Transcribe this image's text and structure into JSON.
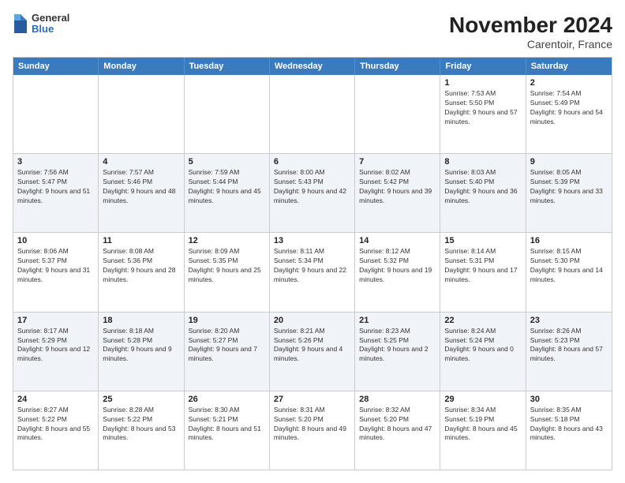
{
  "header": {
    "logo": {
      "general": "General",
      "blue": "Blue"
    },
    "title": "November 2024",
    "location": "Carentoir, France"
  },
  "weekdays": [
    "Sunday",
    "Monday",
    "Tuesday",
    "Wednesday",
    "Thursday",
    "Friday",
    "Saturday"
  ],
  "rows": [
    {
      "alt": false,
      "cells": [
        {
          "day": "",
          "info": ""
        },
        {
          "day": "",
          "info": ""
        },
        {
          "day": "",
          "info": ""
        },
        {
          "day": "",
          "info": ""
        },
        {
          "day": "",
          "info": ""
        },
        {
          "day": "1",
          "info": "Sunrise: 7:53 AM\nSunset: 5:50 PM\nDaylight: 9 hours and 57 minutes."
        },
        {
          "day": "2",
          "info": "Sunrise: 7:54 AM\nSunset: 5:49 PM\nDaylight: 9 hours and 54 minutes."
        }
      ]
    },
    {
      "alt": true,
      "cells": [
        {
          "day": "3",
          "info": "Sunrise: 7:56 AM\nSunset: 5:47 PM\nDaylight: 9 hours and 51 minutes."
        },
        {
          "day": "4",
          "info": "Sunrise: 7:57 AM\nSunset: 5:46 PM\nDaylight: 9 hours and 48 minutes."
        },
        {
          "day": "5",
          "info": "Sunrise: 7:59 AM\nSunset: 5:44 PM\nDaylight: 9 hours and 45 minutes."
        },
        {
          "day": "6",
          "info": "Sunrise: 8:00 AM\nSunset: 5:43 PM\nDaylight: 9 hours and 42 minutes."
        },
        {
          "day": "7",
          "info": "Sunrise: 8:02 AM\nSunset: 5:42 PM\nDaylight: 9 hours and 39 minutes."
        },
        {
          "day": "8",
          "info": "Sunrise: 8:03 AM\nSunset: 5:40 PM\nDaylight: 9 hours and 36 minutes."
        },
        {
          "day": "9",
          "info": "Sunrise: 8:05 AM\nSunset: 5:39 PM\nDaylight: 9 hours and 33 minutes."
        }
      ]
    },
    {
      "alt": false,
      "cells": [
        {
          "day": "10",
          "info": "Sunrise: 8:06 AM\nSunset: 5:37 PM\nDaylight: 9 hours and 31 minutes."
        },
        {
          "day": "11",
          "info": "Sunrise: 8:08 AM\nSunset: 5:36 PM\nDaylight: 9 hours and 28 minutes."
        },
        {
          "day": "12",
          "info": "Sunrise: 8:09 AM\nSunset: 5:35 PM\nDaylight: 9 hours and 25 minutes."
        },
        {
          "day": "13",
          "info": "Sunrise: 8:11 AM\nSunset: 5:34 PM\nDaylight: 9 hours and 22 minutes."
        },
        {
          "day": "14",
          "info": "Sunrise: 8:12 AM\nSunset: 5:32 PM\nDaylight: 9 hours and 19 minutes."
        },
        {
          "day": "15",
          "info": "Sunrise: 8:14 AM\nSunset: 5:31 PM\nDaylight: 9 hours and 17 minutes."
        },
        {
          "day": "16",
          "info": "Sunrise: 8:15 AM\nSunset: 5:30 PM\nDaylight: 9 hours and 14 minutes."
        }
      ]
    },
    {
      "alt": true,
      "cells": [
        {
          "day": "17",
          "info": "Sunrise: 8:17 AM\nSunset: 5:29 PM\nDaylight: 9 hours and 12 minutes."
        },
        {
          "day": "18",
          "info": "Sunrise: 8:18 AM\nSunset: 5:28 PM\nDaylight: 9 hours and 9 minutes."
        },
        {
          "day": "19",
          "info": "Sunrise: 8:20 AM\nSunset: 5:27 PM\nDaylight: 9 hours and 7 minutes."
        },
        {
          "day": "20",
          "info": "Sunrise: 8:21 AM\nSunset: 5:26 PM\nDaylight: 9 hours and 4 minutes."
        },
        {
          "day": "21",
          "info": "Sunrise: 8:23 AM\nSunset: 5:25 PM\nDaylight: 9 hours and 2 minutes."
        },
        {
          "day": "22",
          "info": "Sunrise: 8:24 AM\nSunset: 5:24 PM\nDaylight: 9 hours and 0 minutes."
        },
        {
          "day": "23",
          "info": "Sunrise: 8:26 AM\nSunset: 5:23 PM\nDaylight: 8 hours and 57 minutes."
        }
      ]
    },
    {
      "alt": false,
      "cells": [
        {
          "day": "24",
          "info": "Sunrise: 8:27 AM\nSunset: 5:22 PM\nDaylight: 8 hours and 55 minutes."
        },
        {
          "day": "25",
          "info": "Sunrise: 8:28 AM\nSunset: 5:22 PM\nDaylight: 8 hours and 53 minutes."
        },
        {
          "day": "26",
          "info": "Sunrise: 8:30 AM\nSunset: 5:21 PM\nDaylight: 8 hours and 51 minutes."
        },
        {
          "day": "27",
          "info": "Sunrise: 8:31 AM\nSunset: 5:20 PM\nDaylight: 8 hours and 49 minutes."
        },
        {
          "day": "28",
          "info": "Sunrise: 8:32 AM\nSunset: 5:20 PM\nDaylight: 8 hours and 47 minutes."
        },
        {
          "day": "29",
          "info": "Sunrise: 8:34 AM\nSunset: 5:19 PM\nDaylight: 8 hours and 45 minutes."
        },
        {
          "day": "30",
          "info": "Sunrise: 8:35 AM\nSunset: 5:18 PM\nDaylight: 8 hours and 43 minutes."
        }
      ]
    }
  ]
}
